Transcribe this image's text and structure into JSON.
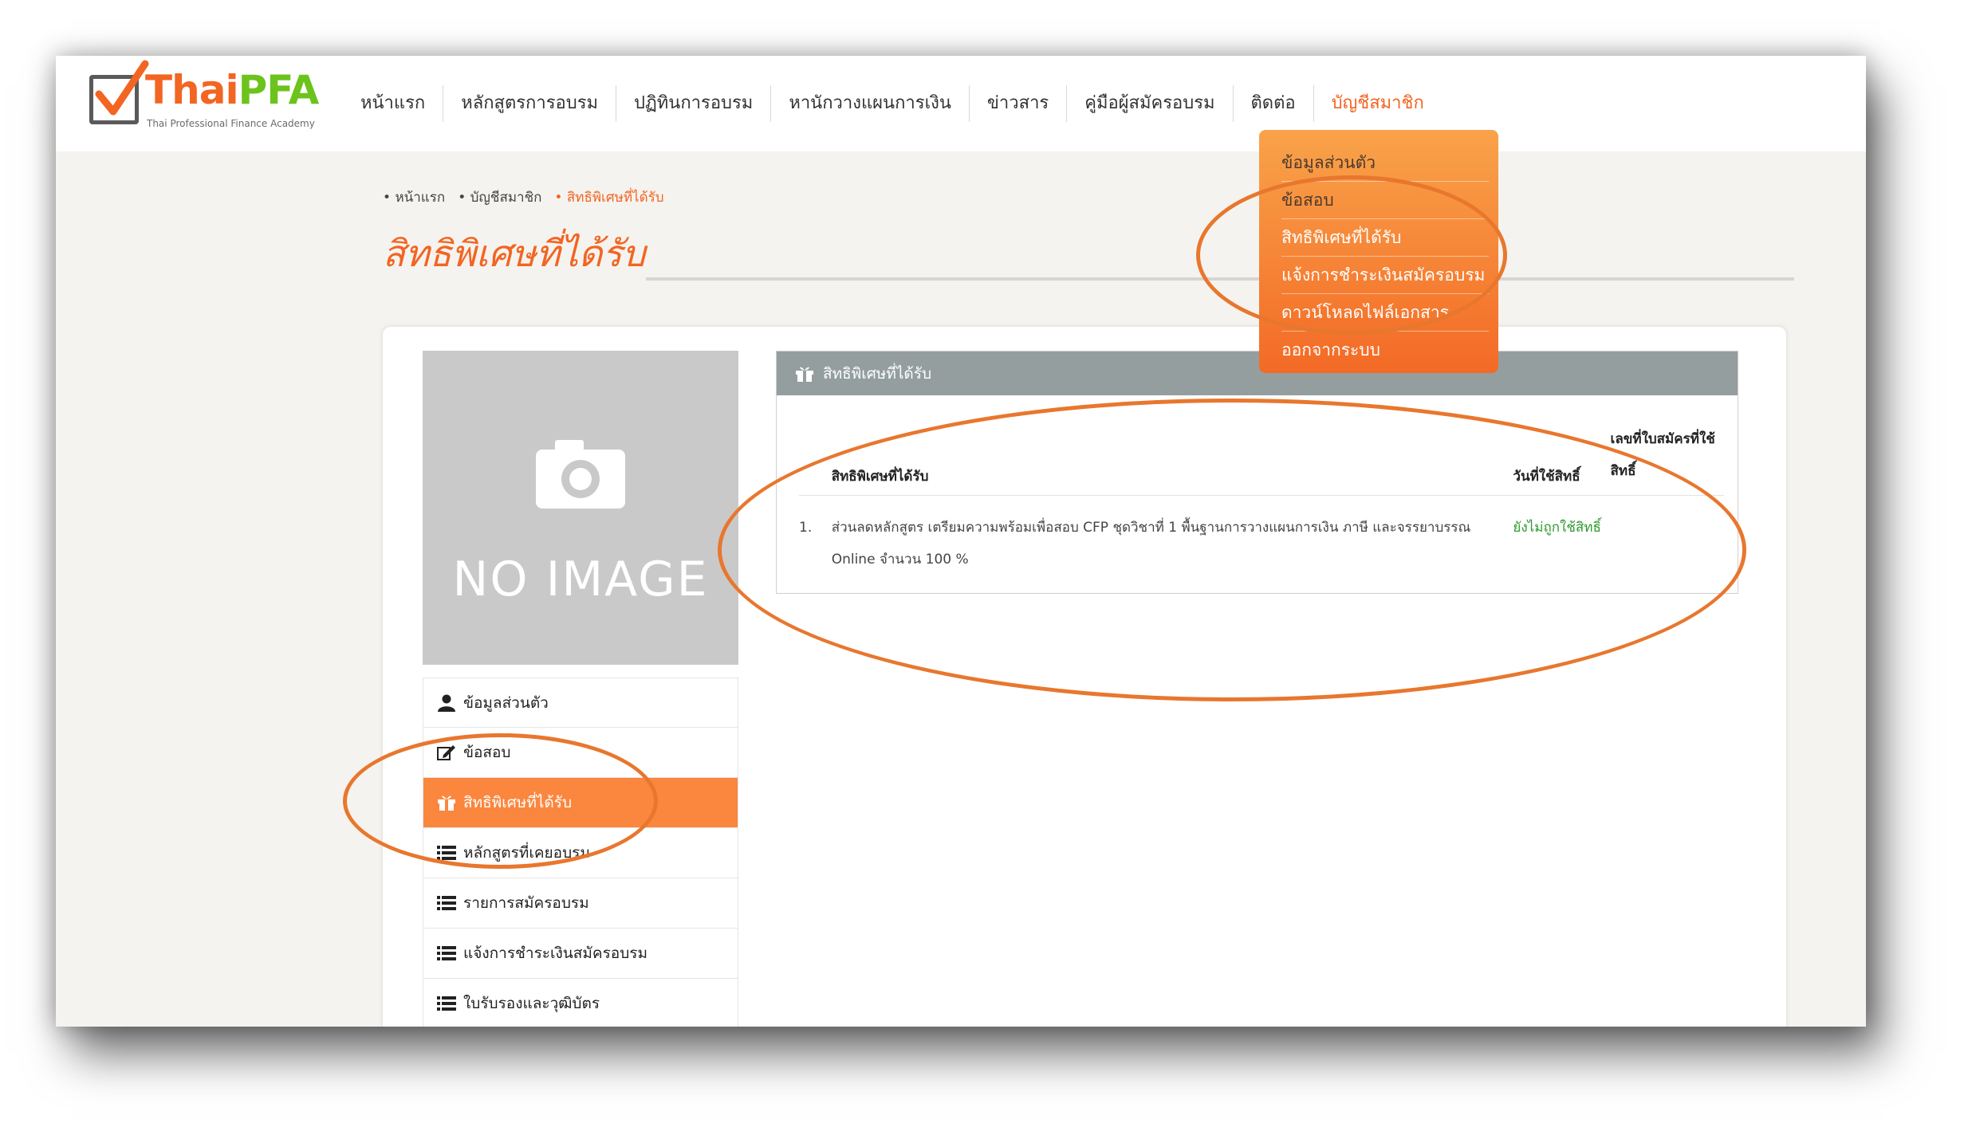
{
  "logo": {
    "brand_a": "Thai",
    "brand_b": "PFA",
    "tagline": "Thai Professional Finance Academy"
  },
  "nav": {
    "items": [
      "หน้าแรก",
      "หลักสูตรการอบรม",
      "ปฏิทินการอบรม",
      "หานักวางแผนการเงิน",
      "ข่าวสาร",
      "คู่มือผู้สมัครอบรม",
      "ติดต่อ",
      "บัญชีสมาชิก"
    ]
  },
  "dropdown": {
    "items": [
      "ข้อมูลส่วนตัว",
      "ข้อสอบ",
      "สิทธิพิเศษที่ได้รับ",
      "แจ้งการชำระเงินสมัครอบรม",
      "ดาวน์โหลดไฟล์เอกสาร",
      "ออกจากระบบ"
    ]
  },
  "breadcrumb": [
    "หน้าแรก",
    "บัญชีสมาชิก",
    "สิทธิพิเศษที่ได้รับ"
  ],
  "page_title": "สิทธิพิเศษที่ได้รับ",
  "profile": {
    "no_image_text": "NO IMAGE"
  },
  "side_menu": {
    "items": [
      {
        "label": "ข้อมูลส่วนตัว",
        "icon": "user-icon"
      },
      {
        "label": "ข้อสอบ",
        "icon": "edit-icon"
      },
      {
        "label": "สิทธิพิเศษที่ได้รับ",
        "icon": "gift-icon"
      },
      {
        "label": "หลักสูตรที่เคยอบรม",
        "icon": "list-icon"
      },
      {
        "label": "รายการสมัครอบรม",
        "icon": "list-icon"
      },
      {
        "label": "แจ้งการชำระเงินสมัครอบรม",
        "icon": "list-icon"
      },
      {
        "label": "ใบรับรองและวุฒิบัตร",
        "icon": "list-icon"
      }
    ]
  },
  "panel": {
    "title": "สิทธิพิเศษที่ได้รับ",
    "columns": {
      "privilege": "สิทธิพิเศษที่ได้รับ",
      "date_used": "วันที่ใช้สิทธิ์",
      "application_no": "เลขที่ใบสมัครที่ใช้สิทธิ์"
    },
    "rows": [
      {
        "num": "1.",
        "privilege": "ส่วนลดหลักสูตร เตรียมความพร้อมเพื่อสอบ CFP ชุดวิชาที่ 1 พื้นฐานการวางแผนการเงิน ภาษี และจรรยาบรรณ Online จำนวน 100 %",
        "status": "ยังไม่ถูกใช้สิทธิ์",
        "application_no": ""
      }
    ]
  },
  "colors": {
    "accent": "#f26522",
    "brand_green": "#6cc31b",
    "highlight": "#e8772e",
    "panel_head": "#949e9e",
    "status_green": "#2e9a2e"
  }
}
